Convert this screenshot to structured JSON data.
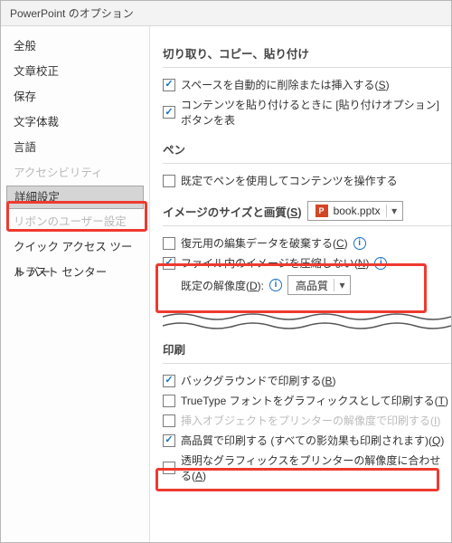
{
  "window_title": "PowerPoint のオプション",
  "sidebar": {
    "items": [
      {
        "label": "全般"
      },
      {
        "label": "文章校正"
      },
      {
        "label": "保存"
      },
      {
        "label": "文字体裁"
      },
      {
        "label": "言語"
      },
      {
        "label": "アクセシビリティ"
      },
      {
        "label": "詳細設定"
      },
      {
        "label": "リボンのユーザー設定"
      },
      {
        "label": "クイック アクセス ツール バー"
      },
      {
        "label": "トラスト センター"
      }
    ]
  },
  "sections": {
    "cut": {
      "title": "切り取り、コピー、貼り付け",
      "opt1_prefix": "スペースを自動的に削除または挿入する(",
      "opt1_key": "S",
      "opt1_suffix": ")",
      "opt2": "コンテンツを貼り付けるときに [貼り付けオプション] ボタンを表"
    },
    "pen": {
      "title": "ペン",
      "opt1": "既定でペンを使用してコンテンツを操作する"
    },
    "image": {
      "title_prefix": "イメージのサイズと画質(",
      "title_key": "S",
      "title_suffix": ")",
      "file_name": "book.pptx",
      "opt_restore_prefix": "復元用の編集データを破棄する(",
      "opt_restore_key": "C",
      "opt_restore_suffix": ")",
      "opt_nocompress_prefix": "ファイル内のイメージを圧縮しない(",
      "opt_nocompress_key": "N",
      "opt_nocompress_suffix": ")",
      "res_label_prefix": "既定の解像度(",
      "res_label_key": "D",
      "res_label_suffix": "):",
      "res_value": "高品質"
    },
    "print": {
      "title": "印刷",
      "opt_bg_prefix": "バックグラウンドで印刷する(",
      "opt_bg_key": "B",
      "opt_bg_suffix": ")",
      "opt_tt_prefix": "TrueType フォントをグラフィックスとして印刷する(",
      "opt_tt_key": "T",
      "opt_tt_suffix": ")",
      "opt_ins_prefix": "挿入オブジェクトをプリンターの解像度で印刷する(",
      "opt_ins_key": "I",
      "opt_ins_suffix": ")",
      "opt_hq_prefix": "高品質で印刷する (すべての影効果も印刷されます)(",
      "opt_hq_key": "Q",
      "opt_hq_suffix": ")",
      "opt_trans_prefix": "透明なグラフィックスをプリンターの解像度に合わせる(",
      "opt_trans_key": "A",
      "opt_trans_suffix": ")"
    }
  }
}
